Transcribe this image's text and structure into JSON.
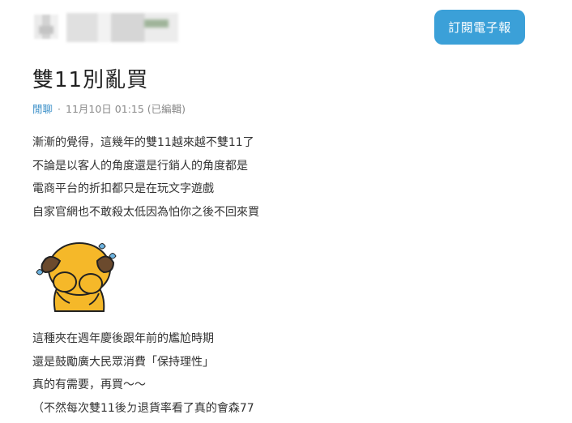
{
  "header": {
    "subscribe_label": "訂閱電子報"
  },
  "post": {
    "title": "雙11別亂買",
    "meta": {
      "category": "閒聊",
      "separator": "·",
      "datetime": "11月10日 01:15",
      "edited": "(已編輯)"
    },
    "paragraph1": [
      "漸漸的覺得，這幾年的雙11越來越不雙11了",
      "不論是以客人的角度還是行銷人的角度都是",
      "電商平台的折扣都只是在玩文字遊戲",
      "自家官網也不敢殺太低因為怕你之後不回來買"
    ],
    "sticker": {
      "icon": "crying-dog-sticker-icon",
      "colors": {
        "body": "#f5b829",
        "outline": "#222222",
        "ears": "#6b4a2d",
        "tears": "#6db3e0"
      }
    },
    "paragraph2": [
      "這種夾在週年慶後跟年前的尷尬時期",
      "還是鼓勵廣大民眾消費「保持理性」",
      "真的有需要，再買～～",
      "（不然每次雙11後ㄉ退貨率看了真的會森77"
    ]
  }
}
